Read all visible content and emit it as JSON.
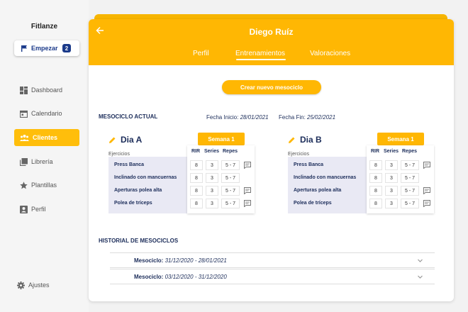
{
  "brand": "Fitlanze",
  "start_button": {
    "label": "Empezar",
    "badge": "2"
  },
  "nav": [
    {
      "label": "Dashboard",
      "icon": "dashboard-icon"
    },
    {
      "label": "Calendario",
      "icon": "calendar-icon"
    },
    {
      "label": "Clientes",
      "icon": "people-icon",
      "active": true
    },
    {
      "label": "Librería",
      "icon": "library-icon"
    },
    {
      "label": "Plantillas",
      "icon": "star-icon"
    },
    {
      "label": "Perfil",
      "icon": "profile-icon"
    }
  ],
  "settings_label": "Ajustes",
  "header": {
    "title": "Diego Ruíz",
    "tabs": [
      "Perfil",
      "Entrenamientos",
      "Valoraciones"
    ],
    "active_tab": "Entrenamientos"
  },
  "create_button": "Crear nuevo mesociclo",
  "mesociclo": {
    "title": "MESOCICLO ACTUAL",
    "start_label": "Fecha Inicio:",
    "start_value": "28/01/2021",
    "end_label": "Fecha Fin:",
    "end_value": "25/02/2021"
  },
  "columns": {
    "exercises": "Ejercicios",
    "rir": "RIR",
    "series": "Series",
    "reps": "Repes"
  },
  "days": [
    {
      "title": "Dia A",
      "week": "Semana 1",
      "exercises": [
        {
          "name": "Press Banca",
          "rir": "8",
          "series": "3",
          "reps": "5 - 7",
          "note": true
        },
        {
          "name": "Inclinado con mancuernas",
          "rir": "8",
          "series": "3",
          "reps": "5 - 7",
          "note": false
        },
        {
          "name": "Aperturas polea alta",
          "rir": "8",
          "series": "3",
          "reps": "5 - 7",
          "note": true
        },
        {
          "name": "Polea de tríceps",
          "rir": "8",
          "series": "3",
          "reps": "5 - 7",
          "note": true
        }
      ]
    },
    {
      "title": "Dia B",
      "week": "Semana 1",
      "exercises": [
        {
          "name": "Press Banca",
          "rir": "8",
          "series": "3",
          "reps": "5 - 7",
          "note": true
        },
        {
          "name": "Inclinado con mancuernas",
          "rir": "8",
          "series": "3",
          "reps": "5 - 7",
          "note": false
        },
        {
          "name": "Aperturas polea alta",
          "rir": "8",
          "series": "3",
          "reps": "5 - 7",
          "note": true
        },
        {
          "name": "Polea de tríceps",
          "rir": "8",
          "series": "3",
          "reps": "5 - 7",
          "note": true
        }
      ]
    }
  ],
  "history": {
    "title": "HISTORIAL DE MESOCICLOS",
    "items": [
      {
        "label": "Mesociclo:",
        "range": "31/12/2020 - 28/01/2021"
      },
      {
        "label": "Mesociclo:",
        "range": "03/12/2020 - 31/12/2020"
      }
    ]
  },
  "colors": {
    "accent": "#ffb703",
    "navy": "#1c2d5a",
    "brand_blue": "#1b3a8a"
  }
}
